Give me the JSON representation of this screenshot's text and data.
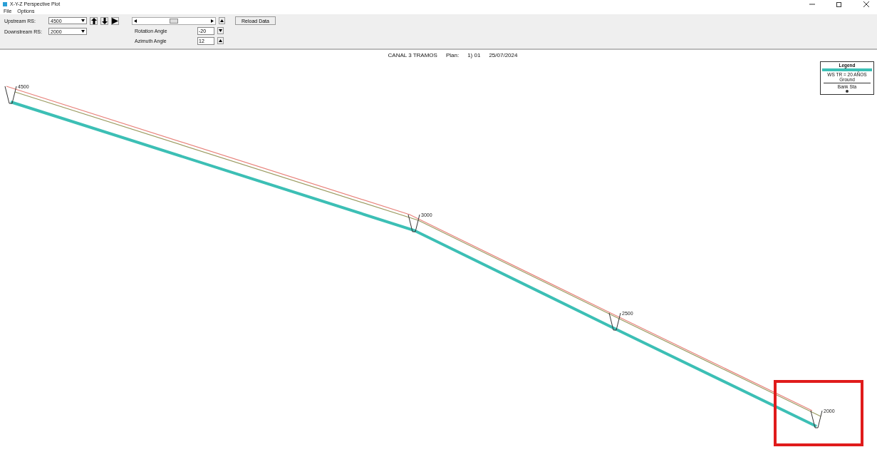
{
  "window": {
    "title": "X-Y-Z Perspective Plot"
  },
  "menu": [
    "File",
    "Options"
  ],
  "toolbar": {
    "upstream_label": "Upstream RS:",
    "upstream_value": "4500",
    "downstream_label": "Downstream RS:",
    "downstream_value": "2000",
    "slider": {
      "level": 0.5
    },
    "rotation_label": "Rotation Angle",
    "rotation_value": "-20",
    "azimuth_label": "Azimuth Angle",
    "azimuth_value": "12",
    "reload_button": "Reload Data"
  },
  "plot": {
    "title": "CANAL 3 TRAMOS",
    "plan_label": "Plan:",
    "plan_value": "1) 01",
    "date": "25/07/2024",
    "stations": [
      {
        "label": "4500",
        "highlighted": false
      },
      {
        "label": "3000",
        "highlighted": false
      },
      {
        "label": "2500",
        "highlighted": false
      },
      {
        "label": "2000",
        "highlighted": true
      }
    ],
    "legend": {
      "title": "Legend",
      "items": [
        {
          "label": "WS TR = 20 AÑOS",
          "kind": "band",
          "color": "#3cbfb5"
        },
        {
          "label": "Ground",
          "kind": "line",
          "color": "#333333"
        },
        {
          "label": "Bank Sta",
          "kind": "dot",
          "color": "#333333"
        }
      ]
    }
  }
}
